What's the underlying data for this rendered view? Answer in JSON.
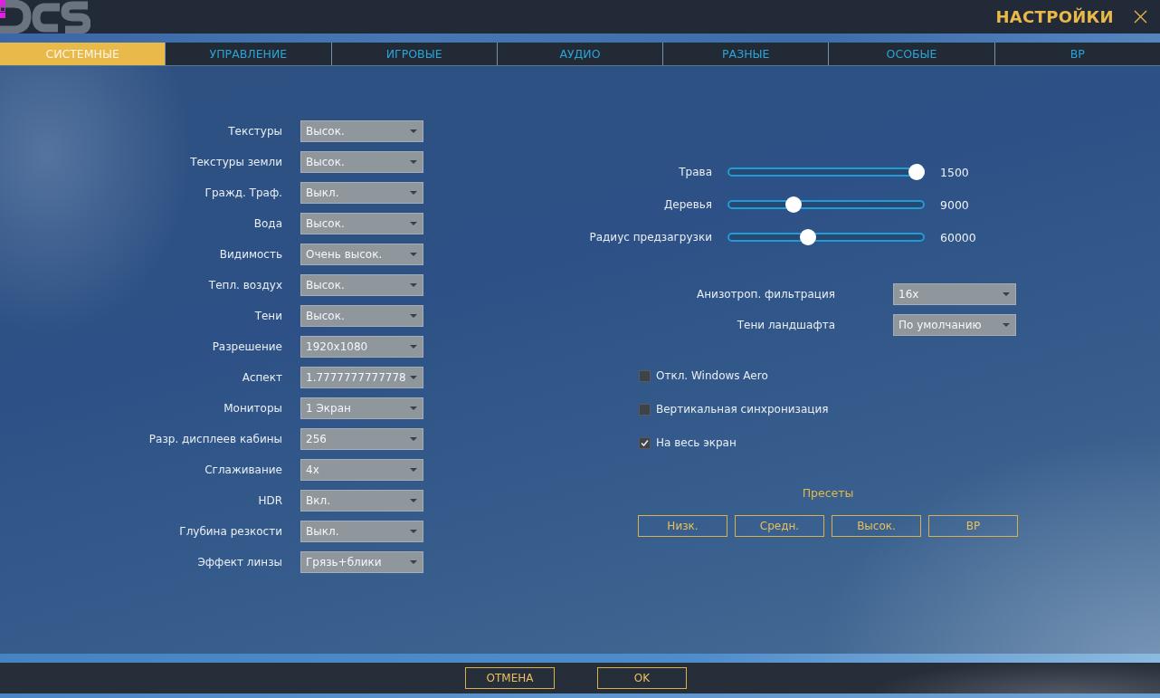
{
  "window": {
    "title": "НАСТРОЙКИ"
  },
  "tabs": [
    {
      "label": "СИСТЕМНЫЕ",
      "selected": true
    },
    {
      "label": "УПРАВЛЕНИЕ",
      "selected": false
    },
    {
      "label": "ИГРОВЫЕ",
      "selected": false
    },
    {
      "label": "АУДИО",
      "selected": false
    },
    {
      "label": "РАЗНЫЕ",
      "selected": false
    },
    {
      "label": "ОСОБЫЕ",
      "selected": false
    },
    {
      "label": "ВР",
      "selected": false
    }
  ],
  "graphics_options": [
    {
      "label": "Текстуры",
      "value": "Высок."
    },
    {
      "label": "Текстуры земли",
      "value": "Высок."
    },
    {
      "label": "Гражд. Траф.",
      "value": "Выкл."
    },
    {
      "label": "Вода",
      "value": "Высок."
    },
    {
      "label": "Видимость",
      "value": "Очень высок."
    },
    {
      "label": "Тепл. воздух",
      "value": "Высок."
    },
    {
      "label": "Тени",
      "value": "Высок."
    },
    {
      "label": "Разрешение",
      "value": "1920x1080"
    },
    {
      "label": "Аспект",
      "value": "1.7777777777778"
    },
    {
      "label": "Мониторы",
      "value": "1 Экран"
    },
    {
      "label": "Разр. дисплеев кабины",
      "value": "256"
    },
    {
      "label": "Сглаживание",
      "value": "4x"
    },
    {
      "label": "HDR",
      "value": "Вкл."
    },
    {
      "label": "Глубина резкости",
      "value": "Выкл."
    },
    {
      "label": "Эффект линзы",
      "value": "Грязь+блики"
    }
  ],
  "sliders": [
    {
      "label": "Трава",
      "level": 1.0,
      "reading": "1500"
    },
    {
      "label": "Деревья",
      "level": 0.32,
      "reading": "9000"
    },
    {
      "label": "Радиус предзагрузки",
      "level": 0.4,
      "reading": "60000"
    }
  ],
  "filter_options": [
    {
      "label": "Анизотроп. фильтрация",
      "value": "16x"
    },
    {
      "label": "Тени ландшафта",
      "value": "По умолчанию"
    }
  ],
  "checkboxes": [
    {
      "label": "Откл. Windows Aero",
      "checked": false
    },
    {
      "label": "Вертикальная синхронизация",
      "checked": false
    },
    {
      "label": "На весь экран",
      "checked": true
    }
  ],
  "presets": {
    "title": "Пресеты",
    "buttons": [
      "Низк.",
      "Средн.",
      "Высок.",
      "ВР"
    ]
  },
  "footer_buttons": [
    "ОТМЕНА",
    "OK"
  ]
}
